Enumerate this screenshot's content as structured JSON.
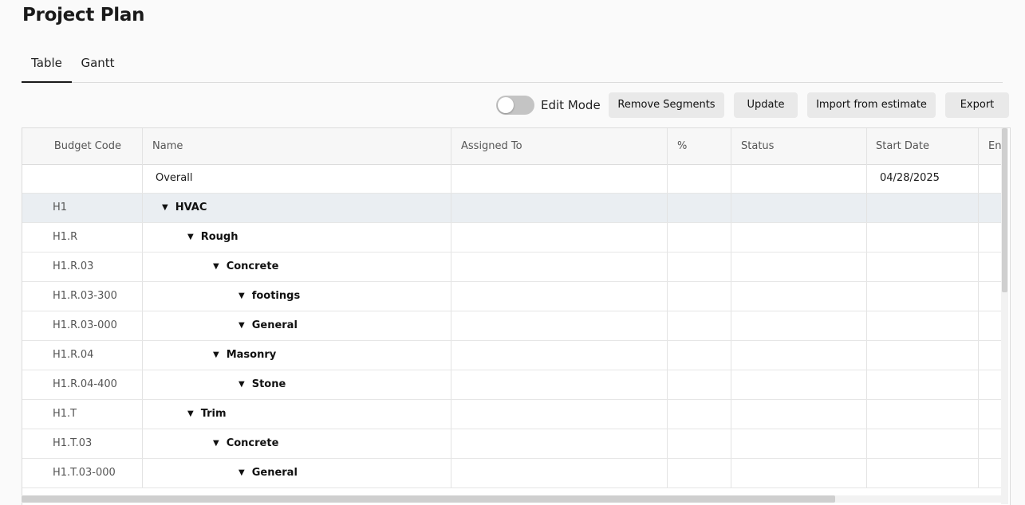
{
  "page": {
    "title": "Project Plan"
  },
  "tabs": [
    {
      "label": "Table",
      "active": true
    },
    {
      "label": "Gantt",
      "active": false
    }
  ],
  "toolbar": {
    "edit_mode_label": "Edit Mode",
    "edit_mode_on": false,
    "remove_segments_label": "Remove Segments",
    "update_label": "Update",
    "import_label": "Import from estimate",
    "export_label": "Export"
  },
  "table": {
    "columns": [
      "Budget Code",
      "Name",
      "Assigned To",
      "%",
      "Status",
      "Start Date",
      "End"
    ],
    "rows": [
      {
        "code": "",
        "name": "Overall",
        "start_date": "04/28/2025",
        "level": 0,
        "group": false
      },
      {
        "code": "H1",
        "name": "HVAC",
        "start_date": "",
        "level": 1,
        "group": true
      },
      {
        "code": "H1.R",
        "name": "Rough",
        "start_date": "",
        "level": 2,
        "group": true
      },
      {
        "code": "H1.R.03",
        "name": "Concrete",
        "start_date": "",
        "level": 3,
        "group": true
      },
      {
        "code": "H1.R.03-300",
        "name": "footings",
        "start_date": "",
        "level": 4,
        "group": true
      },
      {
        "code": "H1.R.03-000",
        "name": "General",
        "start_date": "",
        "level": 4,
        "group": true
      },
      {
        "code": "H1.R.04",
        "name": "Masonry",
        "start_date": "",
        "level": 3,
        "group": true
      },
      {
        "code": "H1.R.04-400",
        "name": "Stone",
        "start_date": "",
        "level": 4,
        "group": true
      },
      {
        "code": "H1.T",
        "name": "Trim",
        "start_date": "",
        "level": 2,
        "group": true
      },
      {
        "code": "H1.T.03",
        "name": "Concrete",
        "start_date": "",
        "level": 3,
        "group": true
      },
      {
        "code": "H1.T.03-000",
        "name": "General",
        "start_date": "",
        "level": 4,
        "group": true
      }
    ],
    "selected_row_index": 1
  },
  "icons": {
    "expanded": "caret-down-icon"
  }
}
